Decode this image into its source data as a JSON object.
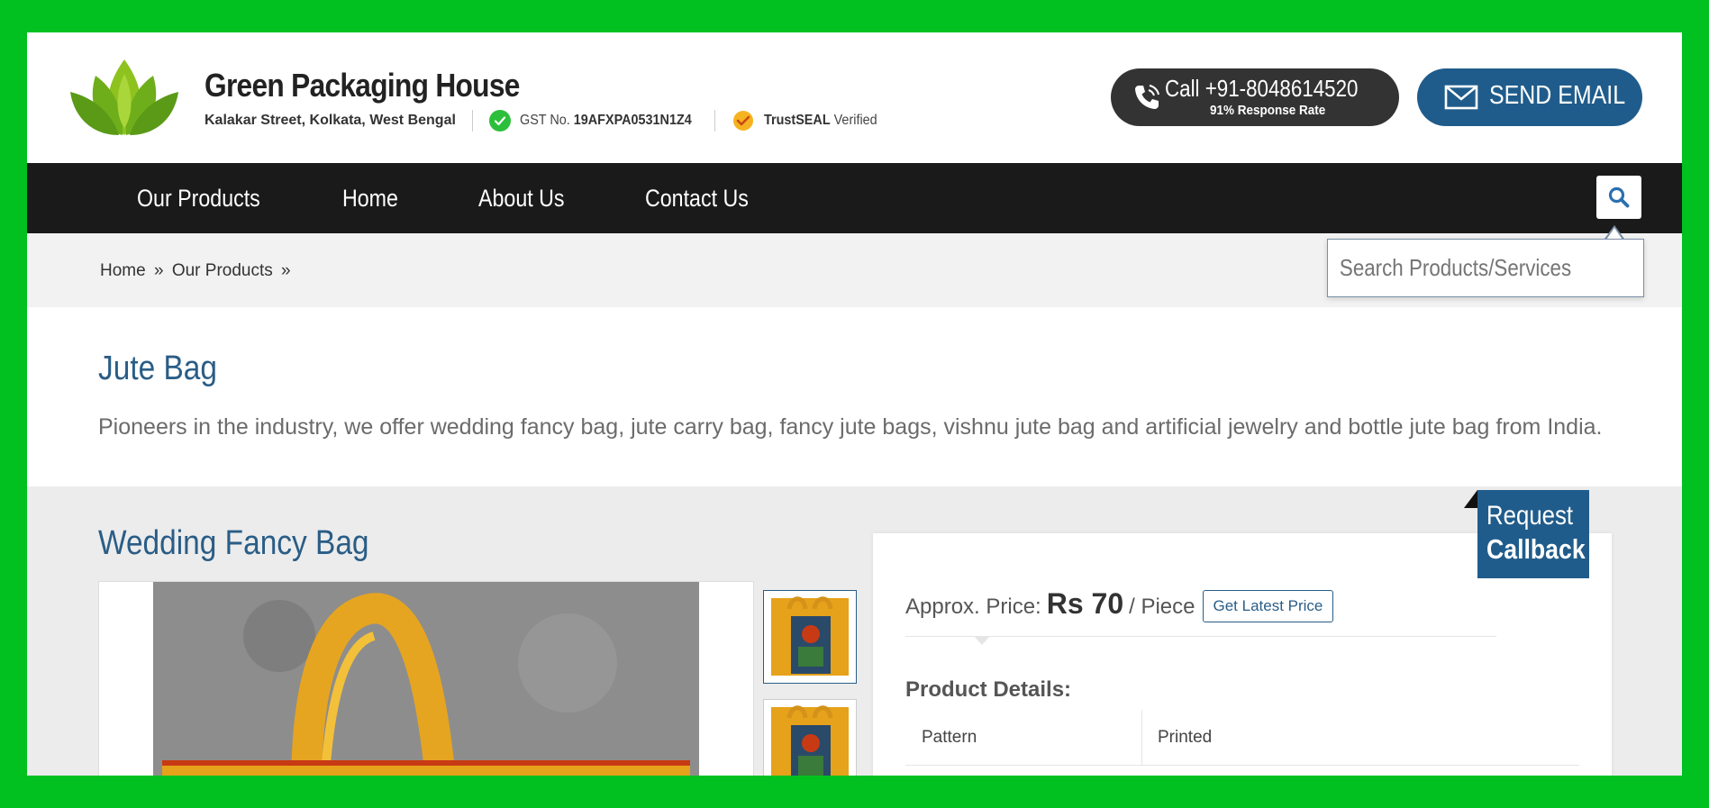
{
  "header": {
    "company_name": "Green Packaging House",
    "address": "Kalakar Street, Kolkata, West Bengal",
    "gst_label": "GST No.",
    "gst_number": "19AFXPA0531N1Z4",
    "trustseal_bold": "TrustSEAL",
    "trustseal_rest": "Verified",
    "call_text": "Call +91-8048614520",
    "call_sub": "91% Response Rate",
    "email_text": "SEND EMAIL"
  },
  "nav": {
    "items": [
      "Our Products",
      "Home",
      "About Us",
      "Contact Us"
    ]
  },
  "breadcrumb": {
    "items": [
      "Home",
      "Our Products"
    ],
    "separator": "»"
  },
  "search": {
    "placeholder": "Search Products/Services"
  },
  "category": {
    "title": "Jute Bag",
    "description": "Pioneers in the industry, we offer wedding fancy bag, jute carry bag, fancy jute bags, vishnu jute bag and artificial jewelry and bottle jute bag from India."
  },
  "product": {
    "title": "Wedding Fancy Bag",
    "price_label": "Approx. Price:",
    "price_value": "Rs 70",
    "price_unit": "/ Piece",
    "latest_price_button": "Get Latest Price",
    "details_heading": "Product Details:",
    "details": [
      {
        "key": "Pattern",
        "value": "Printed"
      }
    ]
  },
  "callback": {
    "line1": "Request",
    "line2": "Callback"
  },
  "colors": {
    "border_green": "#00c11f",
    "brand_blue": "#205c8b",
    "nav_black": "#1a1a1a",
    "call_dark": "#333333"
  },
  "icons": {
    "logo": "lotus-logo-icon",
    "gst": "check-circle-icon",
    "trustseal": "trustseal-badge-icon",
    "call": "phone-icon",
    "email": "envelope-icon",
    "search": "search-icon"
  }
}
